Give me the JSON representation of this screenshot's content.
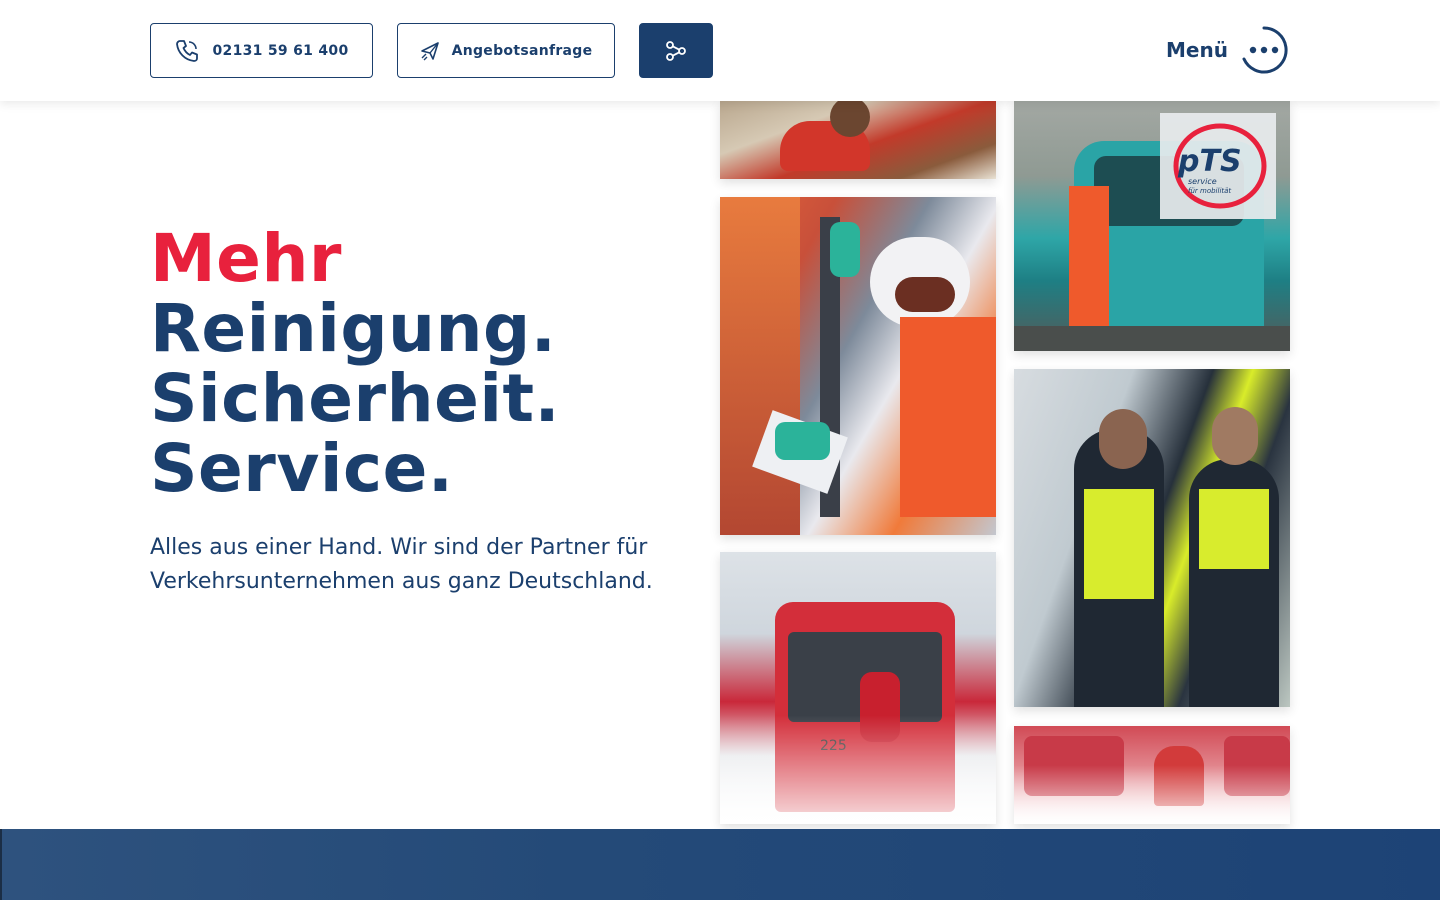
{
  "header": {
    "phone_label": "02131 59 61 400",
    "offer_label": "Angebotsanfrage",
    "menu_label": "Menü"
  },
  "hero": {
    "headline_line1": "Mehr",
    "headline_line2": "Reinigung.",
    "headline_line3": "Sicherheit.",
    "headline_line4": "Service.",
    "lead": "Alles aus einer Hand. Wir sind der Partner für Verkehrsunternehmen aus ganz Deutschland."
  },
  "logo": {
    "brand": "PTS",
    "tagline_1": "service",
    "tagline_2": "für mobilität"
  },
  "bus_number": "225",
  "colors": {
    "brand_blue": "#1b3f6d",
    "brand_red": "#e8213d"
  },
  "icons": [
    "phone-icon",
    "paper-plane-icon",
    "share-icon",
    "menu-dots-icon"
  ]
}
